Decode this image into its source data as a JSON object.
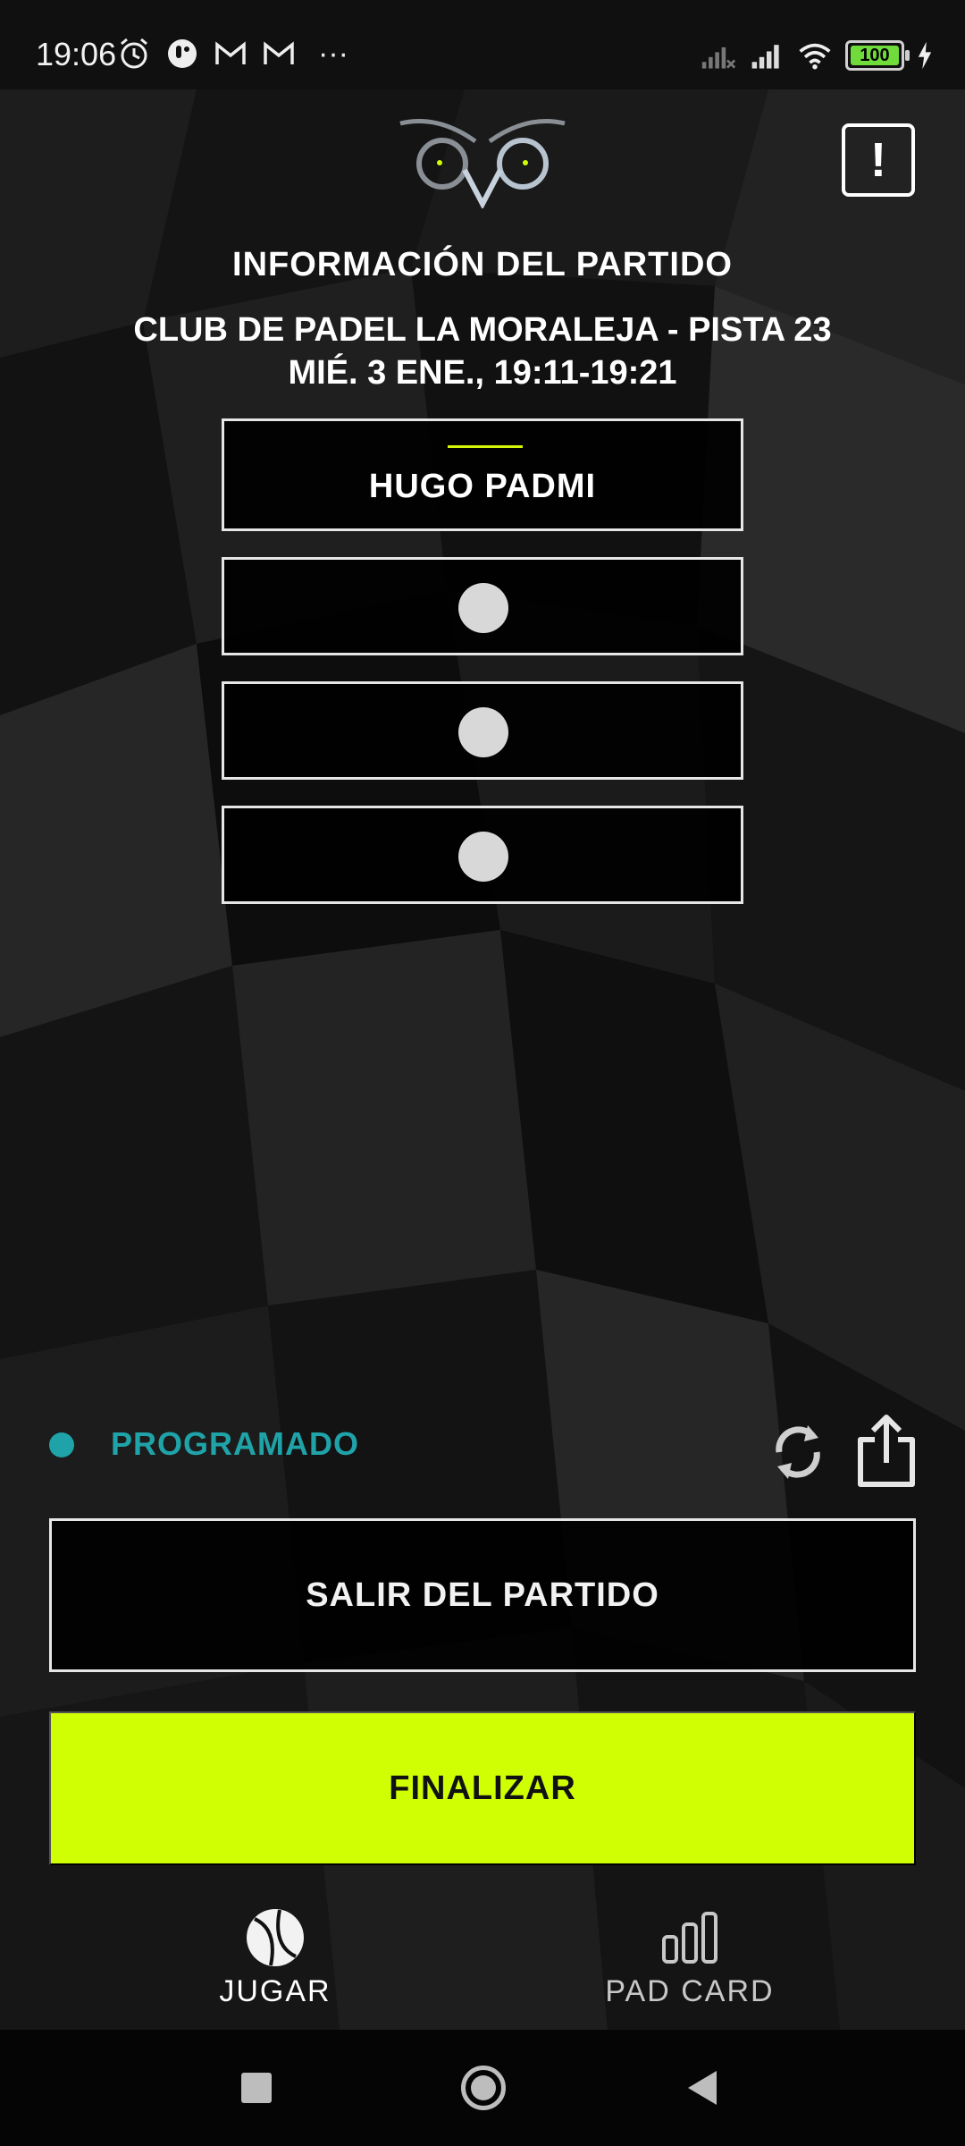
{
  "status_bar": {
    "time": "19:06",
    "battery": "100",
    "left_icons": [
      "alarm-icon",
      "app-notification-icon",
      "gmail-icon",
      "gmail-icon",
      "more-dots-icon"
    ],
    "right_icons": [
      "no-signal-icon",
      "signal-icon",
      "wifi-icon",
      "battery-icon",
      "charging-icon"
    ],
    "more": "···"
  },
  "header": {
    "logo": "owl-logo-icon",
    "alert_symbol": "!",
    "title": "INFORMACIÓN DEL PARTIDO",
    "venue": "CLUB DE PADEL LA MORALEJA - PISTA 23",
    "datetime": "MIÉ. 3 ENE., 19:11-19:21"
  },
  "players": [
    {
      "name": "HUGO PADMI",
      "filled": true
    },
    {
      "name": "",
      "filled": false
    },
    {
      "name": "",
      "filled": false
    },
    {
      "name": "",
      "filled": false
    }
  ],
  "match_status": {
    "label": "PROGRAMADO",
    "color": "#1fa3a8"
  },
  "actions": {
    "leave_label": "SALIR DEL PARTIDO",
    "finish_label": "FINALIZAR",
    "accent_color": "#d0ff04"
  },
  "bottom_nav": {
    "items": [
      {
        "label": "JUGAR",
        "icon": "tennis-ball-icon",
        "active": true
      },
      {
        "label": "PAD CARD",
        "icon": "bar-chart-icon",
        "active": false
      }
    ]
  }
}
